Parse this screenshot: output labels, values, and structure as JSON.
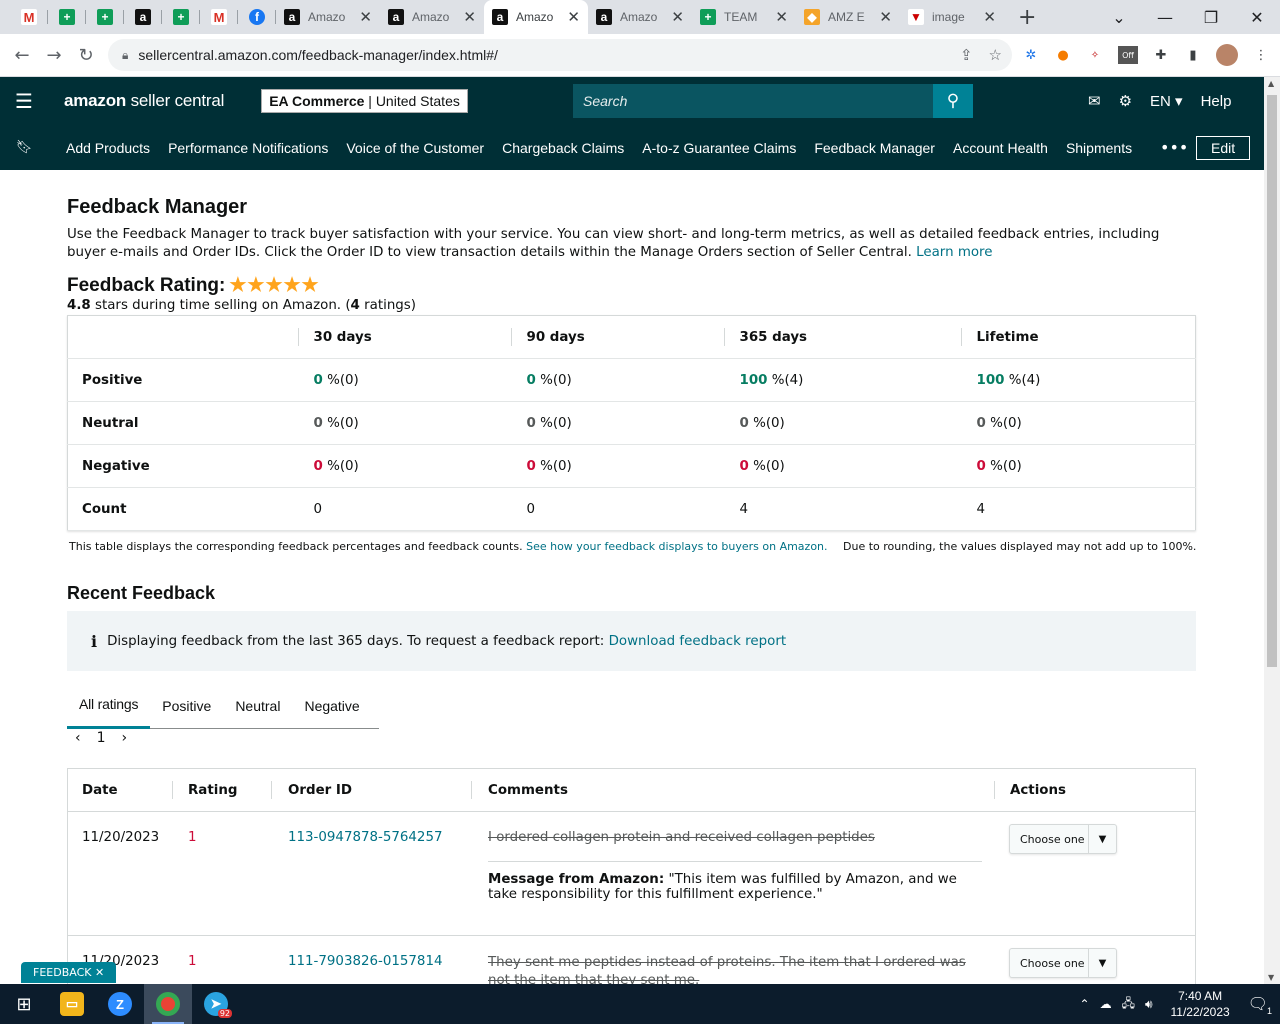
{
  "browser": {
    "tabs": [
      {
        "title": "Amazo",
        "icon": "amazon-icon"
      },
      {
        "title": "Amazo",
        "icon": "amazon-icon"
      },
      {
        "title": "Amazo",
        "icon": "amazon-icon",
        "active": true
      },
      {
        "title": "Amazo",
        "icon": "amazon-icon"
      },
      {
        "title": "TEAM",
        "icon": "sheets-icon"
      },
      {
        "title": "AMZ E",
        "icon": "amz-icon"
      },
      {
        "title": "image",
        "icon": "image-icon"
      }
    ],
    "url": "sellercentral.amazon.com/feedback-manager/index.html#/",
    "extension_badge": "Off"
  },
  "header": {
    "logo_main": "amazon",
    "logo_sub": "seller central",
    "account_name": "EA Commerce",
    "account_region": "United States",
    "search_placeholder": "Search",
    "language": "EN",
    "help": "Help"
  },
  "nav": {
    "items": [
      "Add Products",
      "Performance Notifications",
      "Voice of the Customer",
      "Chargeback Claims",
      "A-to-z Guarantee Claims",
      "Feedback Manager",
      "Account Health",
      "Shipments"
    ],
    "more": "•••",
    "edit": "Edit"
  },
  "page": {
    "title": "Feedback Manager",
    "intro": "Use the Feedback Manager to track buyer satisfaction with your service. You can view short- and long-term metrics, as well as detailed feedback entries, including buyer e-mails and Order IDs. Click the Order ID to view transaction details within the Manage Orders section of Seller Central.",
    "learn_more": "Learn more",
    "rating_label": "Feedback Rating:",
    "stars_value": 4.8,
    "rating_value": "4.8",
    "rating_text_1": "stars during time selling on Amazon. (",
    "rating_count": "4",
    "rating_text_2": "ratings)"
  },
  "metrics": {
    "columns": [
      "30 days",
      "90 days",
      "365 days",
      "Lifetime"
    ],
    "rows": [
      {
        "label": "Positive",
        "cells": [
          [
            "0",
            "%(0)"
          ],
          [
            "0",
            "%(0)"
          ],
          [
            "100",
            "%(4)"
          ],
          [
            "100",
            "%(4)"
          ]
        ]
      },
      {
        "label": "Neutral",
        "cells": [
          [
            "0",
            "%(0)"
          ],
          [
            "0",
            "%(0)"
          ],
          [
            "0",
            "%(0)"
          ],
          [
            "0",
            "%(0)"
          ]
        ]
      },
      {
        "label": "Negative",
        "cells": [
          [
            "0",
            "%(0)"
          ],
          [
            "0",
            "%(0)"
          ],
          [
            "0",
            "%(0)"
          ],
          [
            "0",
            "%(0)"
          ]
        ]
      },
      {
        "label": "Count",
        "cells": [
          [
            "0",
            ""
          ],
          [
            "0",
            ""
          ],
          [
            "4",
            ""
          ],
          [
            "4",
            ""
          ]
        ]
      }
    ],
    "note": "This table displays the corresponding feedback percentages and feedback counts.",
    "note_link": "See how your feedback displays to buyers on Amazon.",
    "note_right": "Due to rounding, the values displayed may not add up to 100%."
  },
  "recent": {
    "title": "Recent Feedback",
    "info": "Displaying feedback from the last 365 days. To request a feedback report:",
    "info_link": "Download feedback report",
    "tabs": [
      "All ratings",
      "Positive",
      "Neutral",
      "Negative"
    ],
    "page": "1",
    "columns": [
      "Date",
      "Rating",
      "Order ID",
      "Comments",
      "Actions"
    ],
    "rows": [
      {
        "date": "11/20/2023",
        "rating": "1",
        "order_id": "113-0947878-5764257",
        "comment": "I ordered collagen protein and received collagen peptides",
        "message_label": "Message from Amazon:",
        "message": "\"This item was fulfilled by Amazon, and we take responsibility for this fulfillment experience.\"",
        "action": "Choose one"
      },
      {
        "date": "11/20/2023",
        "rating": "1",
        "order_id": "111-7903826-0157814",
        "comment": "They sent me peptides instead of proteins. The item that I ordered was not the item that they sent me.",
        "action": "Choose one"
      }
    ],
    "feedback_tab": "FEEDBACK"
  },
  "taskbar": {
    "time": "7:40 AM",
    "date": "11/22/2023",
    "telegram_badge": "92",
    "notification_count": "1"
  }
}
